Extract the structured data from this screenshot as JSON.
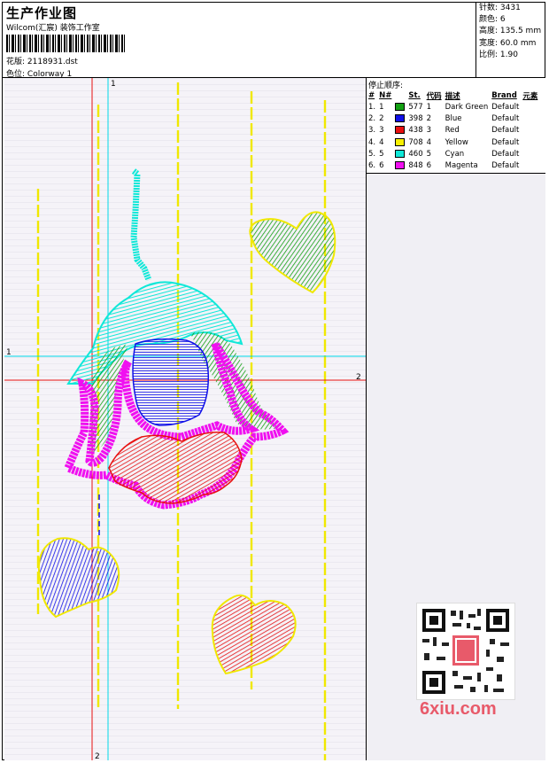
{
  "header": {
    "title": "生产作业图",
    "company": "Wilcom(汇宸) 装饰工作室",
    "design_label": "花版:",
    "design_value": "2118931.dst",
    "colorway_label": "色位:",
    "colorway_value": "Colorway 1"
  },
  "stats": [
    {
      "label": "针数:",
      "value": "3431"
    },
    {
      "label": "颜色:",
      "value": "6"
    },
    {
      "label": "高度:",
      "value": "135.5 mm"
    },
    {
      "label": "宽度:",
      "value": "60.0 mm"
    },
    {
      "label": "比例:",
      "value": "1.90"
    }
  ],
  "stop_sequence": {
    "title": "停止顺序:",
    "columns": [
      "#",
      "N#",
      "St.",
      "代码",
      "描述",
      "Brand",
      "元素"
    ],
    "rows": [
      {
        "num": "1.",
        "n": "1",
        "color": "#12a012",
        "st": "577",
        "code": "1",
        "desc": "Dark Green",
        "brand": "Default"
      },
      {
        "num": "2.",
        "n": "2",
        "color": "#1010e8",
        "st": "398",
        "code": "2",
        "desc": "Blue",
        "brand": "Default"
      },
      {
        "num": "3.",
        "n": "3",
        "color": "#e81010",
        "st": "438",
        "code": "3",
        "desc": "Red",
        "brand": "Default"
      },
      {
        "num": "4.",
        "n": "4",
        "color": "#f8f000",
        "st": "708",
        "code": "4",
        "desc": "Yellow",
        "brand": "Default"
      },
      {
        "num": "5.",
        "n": "5",
        "color": "#10e8d8",
        "st": "460",
        "code": "5",
        "desc": "Cyan",
        "brand": "Default"
      },
      {
        "num": "6.",
        "n": "6",
        "color": "#f010f0",
        "st": "848",
        "code": "6",
        "desc": "Magenta",
        "brand": "Default"
      }
    ]
  },
  "guides": {
    "cyan_top": "1",
    "cyan_left": "1",
    "red_right": "2",
    "red_bottom": "2"
  },
  "watermark": "6xiu.com",
  "icons": {
    "qr": "qr-code-icon",
    "barcode": "barcode-icon"
  }
}
